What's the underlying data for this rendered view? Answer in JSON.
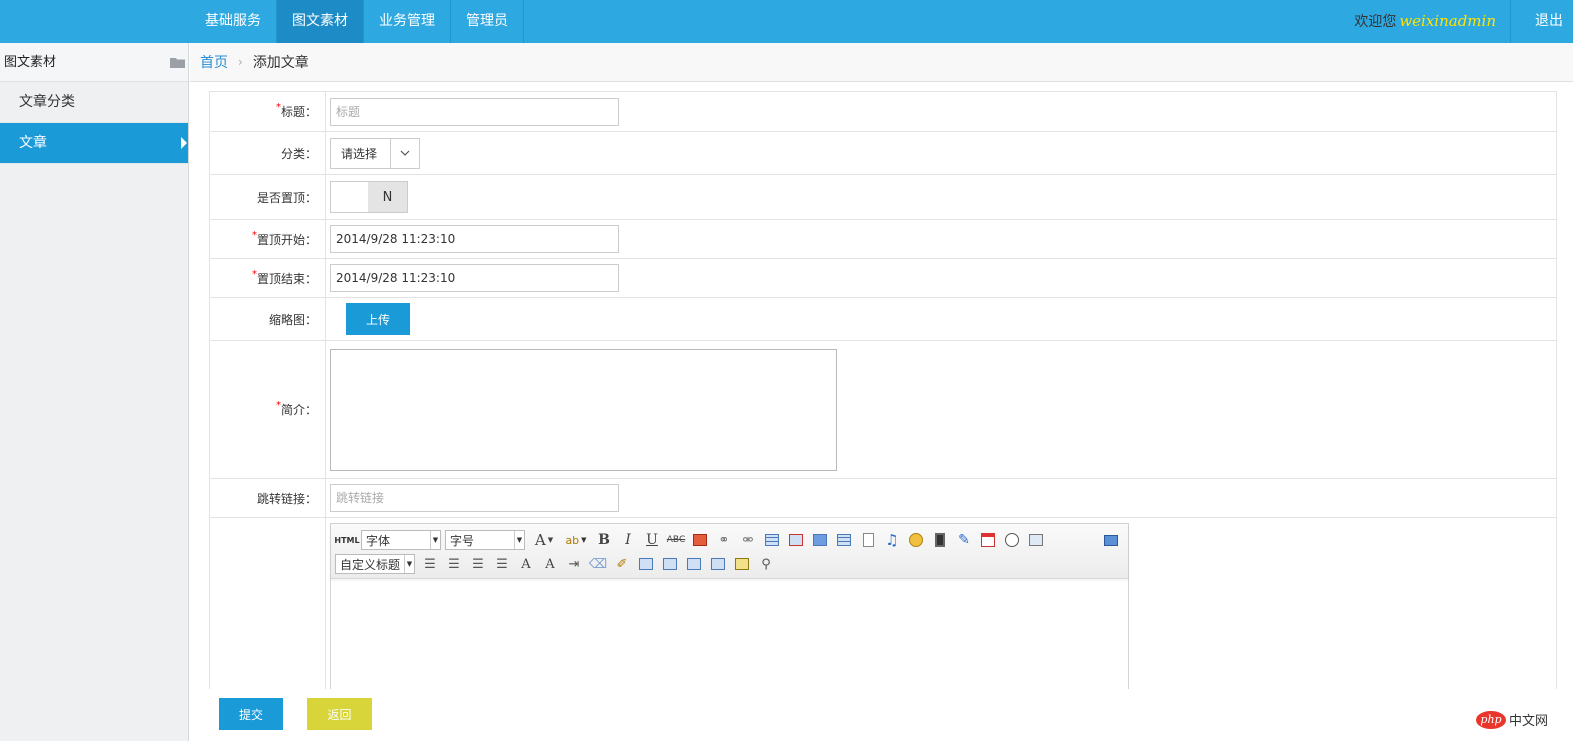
{
  "topnav": {
    "items": [
      {
        "label": "基础服务",
        "active": false
      },
      {
        "label": "图文素材",
        "active": true
      },
      {
        "label": "业务管理",
        "active": false
      },
      {
        "label": "管理员",
        "active": false
      }
    ],
    "welcome_text": "欢迎您",
    "username": "weixinadmin",
    "logout_label": "退出"
  },
  "sidebar": {
    "header": "图文素材",
    "items": [
      {
        "label": "文章分类",
        "active": false
      },
      {
        "label": "文章",
        "active": true
      }
    ]
  },
  "breadcrumb": {
    "home": "首页",
    "separator": "›",
    "current": "添加文章"
  },
  "form": {
    "title": {
      "label": "标题：",
      "required": true,
      "placeholder": "标题",
      "value": ""
    },
    "category": {
      "label": "分类：",
      "selected": "请选择"
    },
    "pin": {
      "label": "是否置顶：",
      "value": "N"
    },
    "pin_start": {
      "label": "置顶开始：",
      "required": true,
      "value": "2014/9/28 11:23:10"
    },
    "pin_end": {
      "label": "置顶结束：",
      "required": true,
      "value": "2014/9/28 11:23:10"
    },
    "thumbnail": {
      "label": "缩略图：",
      "button": "上传"
    },
    "summary": {
      "label": "简介：",
      "required": true,
      "value": ""
    },
    "link": {
      "label": "跳转链接：",
      "placeholder": "跳转链接",
      "value": ""
    },
    "editor": {
      "html_label": "HTML",
      "font_family": "字体",
      "font_size": "字号",
      "custom_heading": "自定义标题",
      "required_mark": "*"
    }
  },
  "actions": {
    "submit": "提交",
    "back": "返回"
  },
  "watermark": {
    "badge": "php",
    "text": "中文网"
  },
  "colors": {
    "topbar": "#2ea8e0",
    "active_nav": "#1d8cc6",
    "sidebar_active": "#1b9ad8",
    "submit": "#1b9ad8",
    "back": "#d7d53a",
    "username": "#ffe400"
  }
}
